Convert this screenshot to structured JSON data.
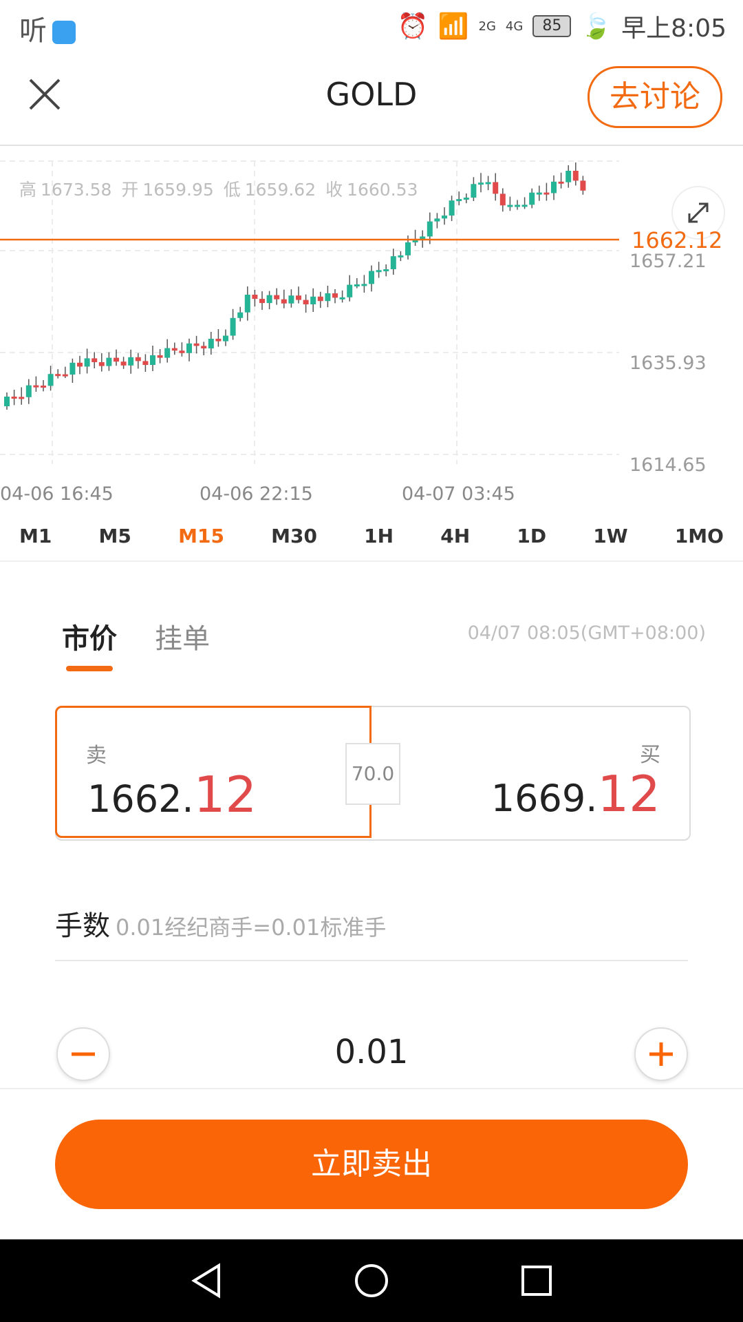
{
  "status_bar": {
    "app_label": "听",
    "network_2g": "2G",
    "network_4g": "4G",
    "battery": "85",
    "time": "早上8:05"
  },
  "header": {
    "title": "GOLD",
    "discuss_button": "去讨论"
  },
  "chart": {
    "ohlc": {
      "high_label": "高",
      "high": "1673.58",
      "open_label": "开",
      "open": "1659.95",
      "low_label": "低",
      "low": "1659.62",
      "close_label": "收",
      "close": "1660.53"
    },
    "y_ticks": [
      "1657.21",
      "1635.93",
      "1614.65"
    ],
    "current_price": "1662.12",
    "x_ticks": [
      "04-06 16:45",
      "04-06 22:15",
      "04-07 03:45"
    ],
    "colors": {
      "up": "#26b496",
      "down": "#e14a4a",
      "price_line": "#f26a11"
    }
  },
  "timeframes": [
    "M1",
    "M5",
    "M15",
    "M30",
    "1H",
    "4H",
    "1D",
    "1W",
    "1MO"
  ],
  "active_timeframe": "M15",
  "order_tabs": [
    "市价",
    "挂单"
  ],
  "active_order_tab": "市价",
  "timestamp": "04/07 08:05(GMT+08:00)",
  "sell": {
    "label": "卖",
    "price_main": "1662.",
    "price_big": "12"
  },
  "buy": {
    "label": "买",
    "price_main": "1669.",
    "price_big": "12"
  },
  "spread": "70.0",
  "lots": {
    "label": "手数",
    "hint": "0.01经纪商手=0.01标准手"
  },
  "quantity": "0.01",
  "action_button": "立即卖出",
  "accent_color": "#f96507"
}
